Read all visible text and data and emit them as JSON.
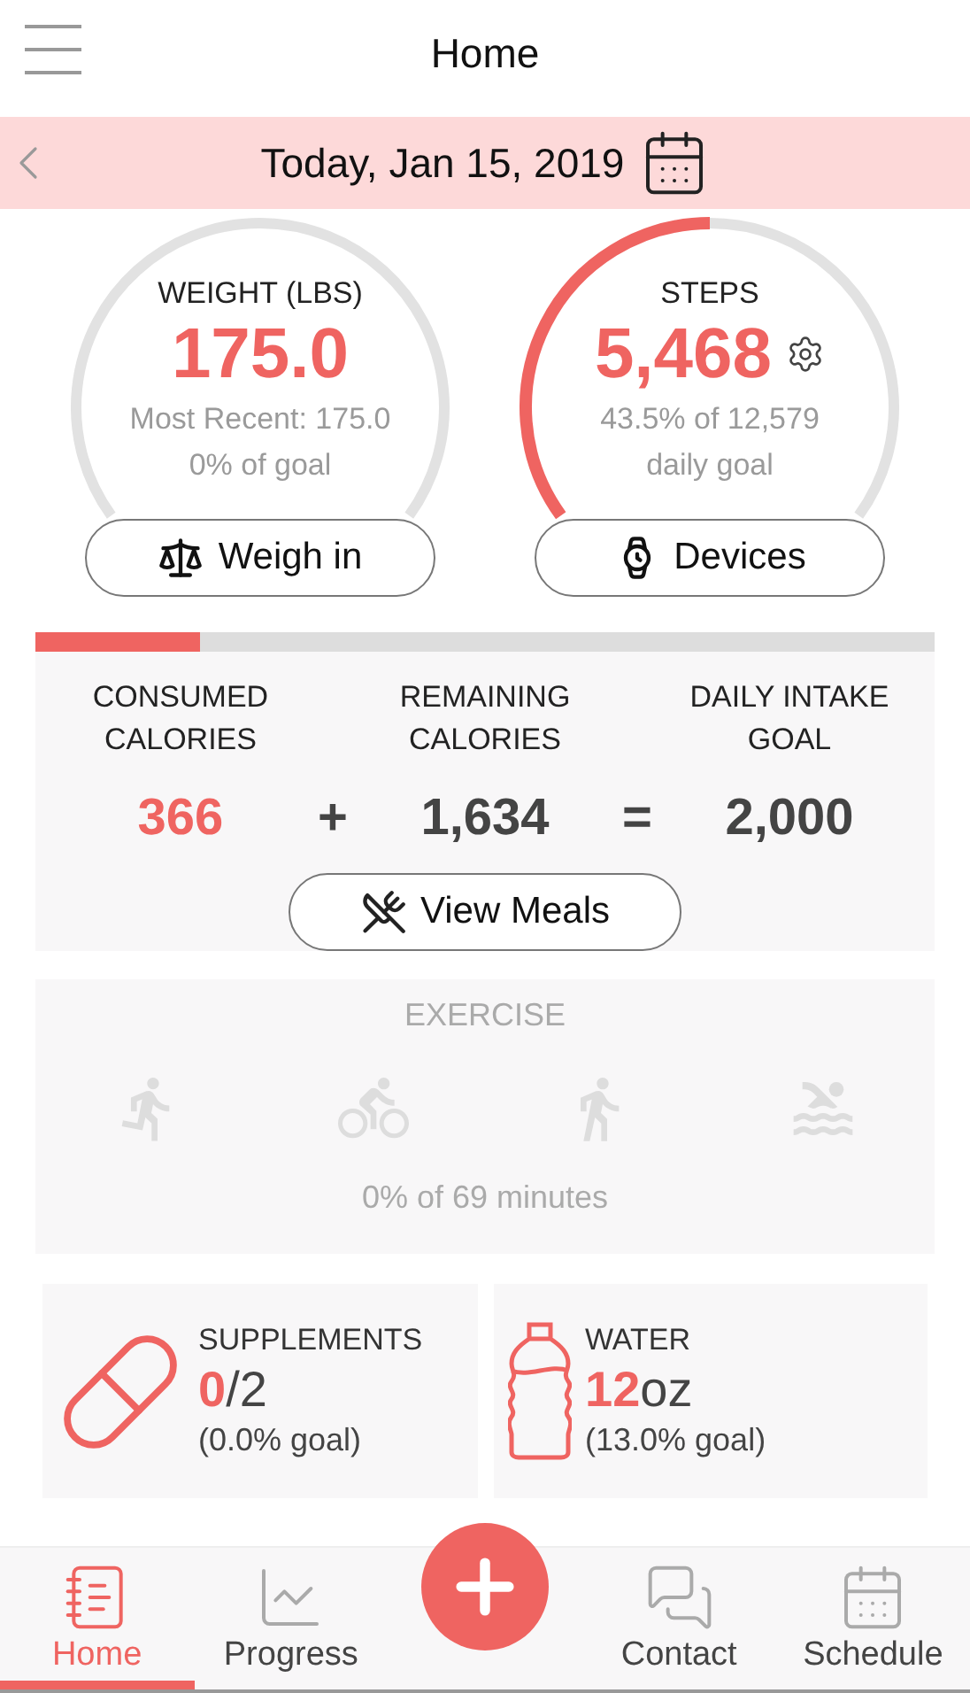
{
  "header": {
    "title": "Home"
  },
  "date_bar": {
    "label": "Today, Jan 15, 2019"
  },
  "gauges": [
    {
      "kind": "weight",
      "title": "WEIGHT (LBS)",
      "value": "175.0",
      "lines": [
        "Most Recent: 175.0",
        "0% of goal"
      ],
      "button": "Weigh in"
    },
    {
      "kind": "steps",
      "title": "STEPS",
      "value": "5,468",
      "lines": [
        "43.5% of 12,579",
        "daily goal"
      ],
      "button": "Devices"
    }
  ],
  "calories": {
    "level": 0.183,
    "columns": [
      {
        "label": "CONSUMED CALORIES",
        "value": "366",
        "highlight": true
      },
      {
        "label": "REMAINING CALORIES",
        "value": "1,634",
        "highlight": false
      },
      {
        "label": "DAILY INTAKE GOAL",
        "value": "2,000",
        "highlight": false
      }
    ],
    "operators": [
      "+",
      "="
    ],
    "button": "View Meals"
  },
  "exercise": {
    "title": "EXERCISE",
    "activities": [
      {
        "kind": "step"
      },
      {
        "kind": "bike"
      },
      {
        "kind": "walk"
      },
      {
        "kind": "swim"
      }
    ],
    "summary": "0% of 69 minutes"
  },
  "tiles": [
    {
      "kind": "supplements",
      "title": "SUPPLEMENTS",
      "amount": "0",
      "rest": "/2",
      "note": "(0.0% goal)"
    },
    {
      "kind": "water",
      "title": "WATER",
      "amount": "12",
      "rest": "oz",
      "note": "(13.0% goal)"
    }
  ],
  "nav": [
    {
      "kind": "home",
      "label": "Home",
      "selected": true
    },
    {
      "kind": "progress",
      "label": "Progress",
      "selected": false
    },
    {
      "kind": "add",
      "selected": false
    },
    {
      "kind": "contact",
      "label": "Contact",
      "selected": false
    },
    {
      "kind": "schedule",
      "label": "Schedule",
      "selected": false
    }
  ]
}
